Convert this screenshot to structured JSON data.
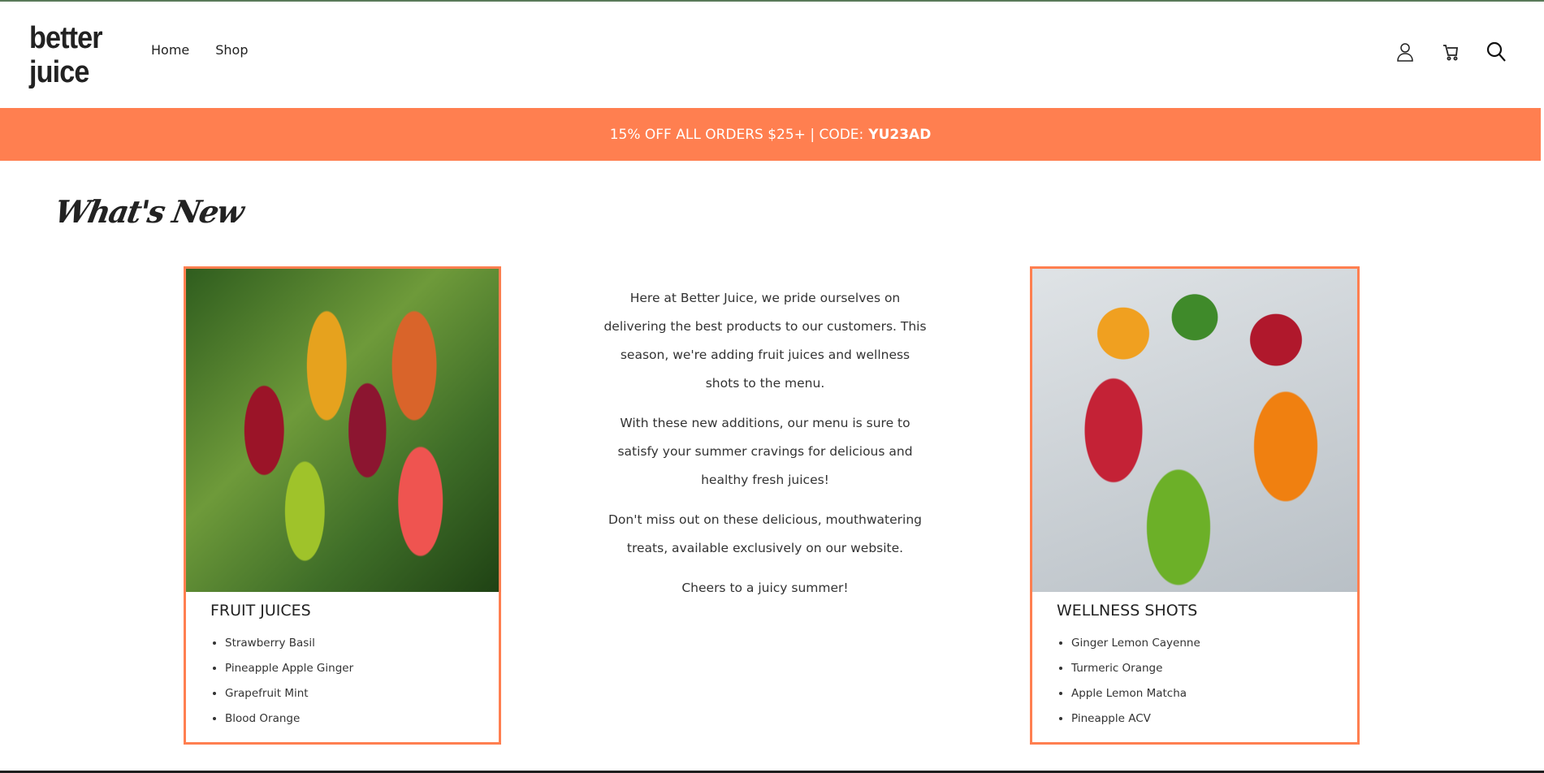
{
  "header": {
    "logo_line1": "better",
    "logo_line2": "juice",
    "nav": [
      {
        "label": "Home"
      },
      {
        "label": "Shop"
      }
    ],
    "icons": [
      "user-icon",
      "cart-icon",
      "search-icon"
    ]
  },
  "banner": {
    "text": "15% OFF ALL ORDERS $25+ | CODE:",
    "code": "YU23AD",
    "color": "#FF7F50"
  },
  "section_title": "What's New",
  "fruit_card": {
    "title": "FRUIT JUICES",
    "items": [
      "Strawberry Basil",
      "Pineapple Apple Ginger",
      "Grapefruit Mint",
      "Blood Orange"
    ]
  },
  "wellness_card": {
    "title": "WELLNESS SHOTS",
    "items": [
      "Ginger Lemon Cayenne",
      "Turmeric Orange",
      "Apple Lemon Matcha",
      "Pineapple ACV"
    ]
  },
  "middle": {
    "paragraphs": [
      "Here at Better Juice, we pride ourselves on delivering the best products to our customers. This season, we're adding fruit juices and wellness shots to the menu.",
      "With these new additions, our menu is sure to satisfy your summer cravings for delicious and healthy fresh juices!",
      "Don't miss out on these delicious, mouthwatering treats, available exclusively on our website.",
      "Cheers to a juicy summer!"
    ]
  }
}
